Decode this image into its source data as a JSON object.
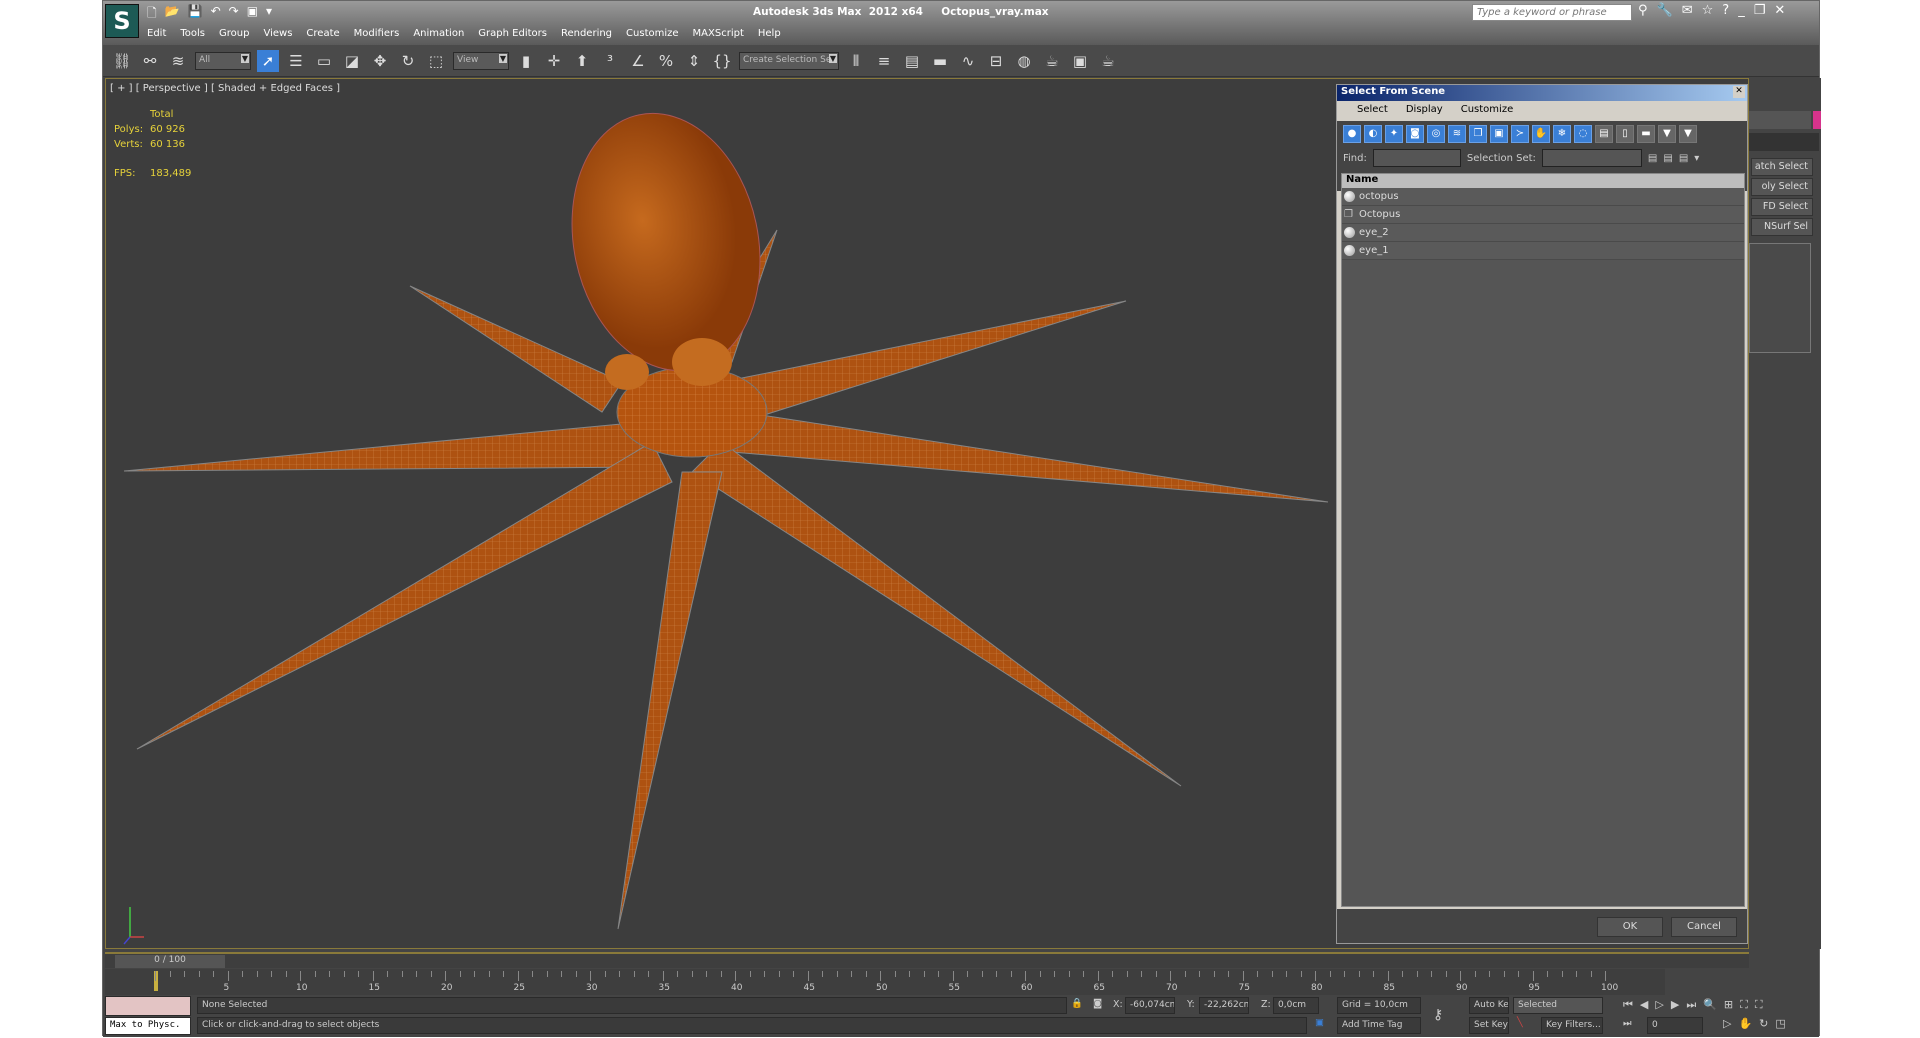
{
  "app": {
    "title": "Autodesk 3ds Max  2012 x64     Octopus_vray.max",
    "search_placeholder": "Type a keyword or phrase",
    "logo": "S"
  },
  "menu": [
    "Edit",
    "Tools",
    "Group",
    "Views",
    "Create",
    "Modifiers",
    "Animation",
    "Graph Editors",
    "Rendering",
    "Customize",
    "MAXScript",
    "Help"
  ],
  "toolbar": {
    "filter": "All",
    "ref_coord": "View",
    "selection_set": "Create Selection Se"
  },
  "viewport": {
    "label": "[ + ] [ Perspective ] [ Shaded + Edged Faces ]",
    "total_label": "Total",
    "polys_label": "Polys:",
    "polys": "60 926",
    "verts_label": "Verts:",
    "verts": "60 136",
    "fps_label": "FPS:",
    "fps": "183,489"
  },
  "command_panel": {
    "buttons": [
      "atch Select",
      "oly Select",
      "FD Select",
      "NSurf Sel"
    ],
    "color": "#d6338c"
  },
  "dialog": {
    "title": "Select From Scene",
    "menu": [
      "Select",
      "Display",
      "Customize"
    ],
    "find_label": "Find:",
    "selection_set_label": "Selection Set:",
    "column": "Name",
    "items": [
      "octopus",
      "Octopus",
      "eye_2",
      "eye_1"
    ],
    "ok": "OK",
    "cancel": "Cancel"
  },
  "timeline": {
    "position": "0 / 100",
    "ticks": [
      "5",
      "10",
      "15",
      "20",
      "25",
      "30",
      "35",
      "40",
      "45",
      "50",
      "55",
      "60",
      "65",
      "70",
      "75",
      "80",
      "85",
      "90",
      "95",
      "100"
    ]
  },
  "status": {
    "maxscript": "Max to Physc.",
    "selection": "None Selected",
    "prompt": "Click or click-and-drag to select objects",
    "x_label": "X:",
    "x": "-60,074cm",
    "y_label": "Y:",
    "y": "-22,262cm",
    "z_label": "Z:",
    "z": "0,0cm",
    "grid": "Grid = 10,0cm",
    "add_time_tag": "Add Time Tag",
    "auto_key": "Auto Key",
    "key_mode": "Selected",
    "set_key": "Set Key",
    "key_filters": "Key Filters...",
    "frame": "0"
  }
}
